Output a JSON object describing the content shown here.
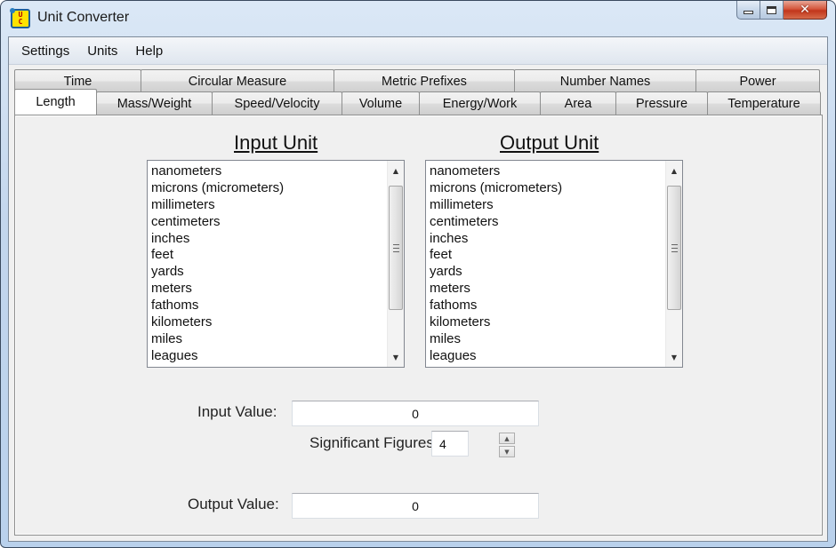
{
  "window": {
    "title": "Unit Converter",
    "icon_letters": [
      "U",
      "C"
    ],
    "buttons": {
      "minimize": "minimize",
      "maximize": "maximize",
      "close": "✕"
    }
  },
  "menu": {
    "items": [
      "Settings",
      "Units",
      "Help"
    ]
  },
  "tabs": {
    "back_row": [
      "Time",
      "Circular Measure",
      "Metric Prefixes",
      "Number Names",
      "Power"
    ],
    "front_row": [
      "Length",
      "Mass/Weight",
      "Speed/Velocity",
      "Volume",
      "Energy/Work",
      "Area",
      "Pressure",
      "Temperature"
    ],
    "active": "Length"
  },
  "input_unit": {
    "title": "Input Unit",
    "items": [
      "nanometers",
      "microns (micrometers)",
      "millimeters",
      "centimeters",
      "inches",
      "feet",
      "yards",
      "meters",
      "fathoms",
      "kilometers",
      "miles",
      "leagues"
    ]
  },
  "output_unit": {
    "title": "Output Unit",
    "items": [
      "nanometers",
      "microns (micrometers)",
      "millimeters",
      "centimeters",
      "inches",
      "feet",
      "yards",
      "meters",
      "fathoms",
      "kilometers",
      "miles",
      "leagues"
    ]
  },
  "input_value": {
    "label": "Input Value:",
    "value": "0"
  },
  "significant_figures": {
    "label": "Significant Figures:",
    "value": "4"
  },
  "output_value": {
    "label": "Output Value:",
    "value": "0"
  },
  "icons": {
    "scroll_up": "▲",
    "scroll_down": "▼",
    "spin_up": "▲",
    "spin_down": "▼"
  }
}
